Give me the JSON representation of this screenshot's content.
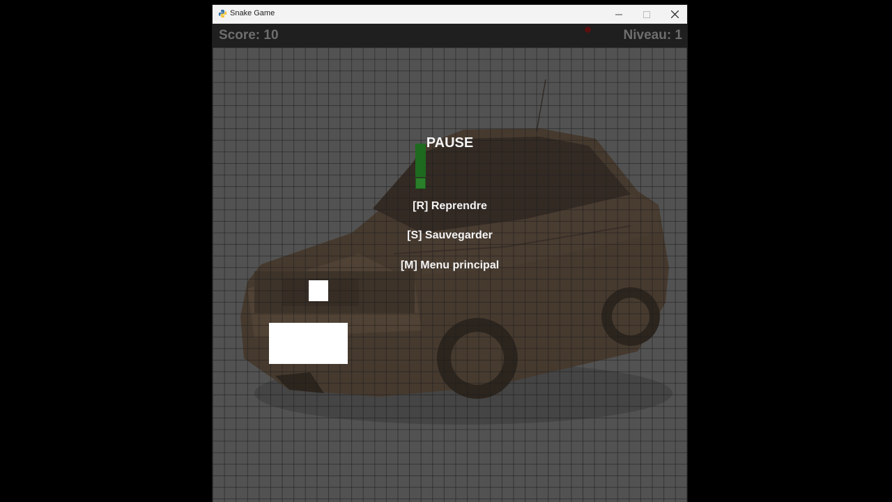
{
  "window": {
    "title": "Snake Game",
    "app_icon": "python-icon",
    "controls": {
      "minimize_icon": "minimize-icon",
      "maximize_icon": "maximize-icon",
      "close_icon": "close-icon"
    }
  },
  "hud": {
    "score_text": "Score: 10",
    "level_text": "Niveau: 1"
  },
  "pause_menu": {
    "title": "PAUSE",
    "options": [
      {
        "label": "[R] Reprendre"
      },
      {
        "label": "[S] Sauvegarder"
      },
      {
        "label": "[M] Menu principal"
      }
    ]
  },
  "colors": {
    "snake": "#1e6a1e",
    "food": "#5a0f0f",
    "grid_line": "#141414",
    "hud_text": "#6e6e6e",
    "menu_text": "#f4f4f4"
  }
}
